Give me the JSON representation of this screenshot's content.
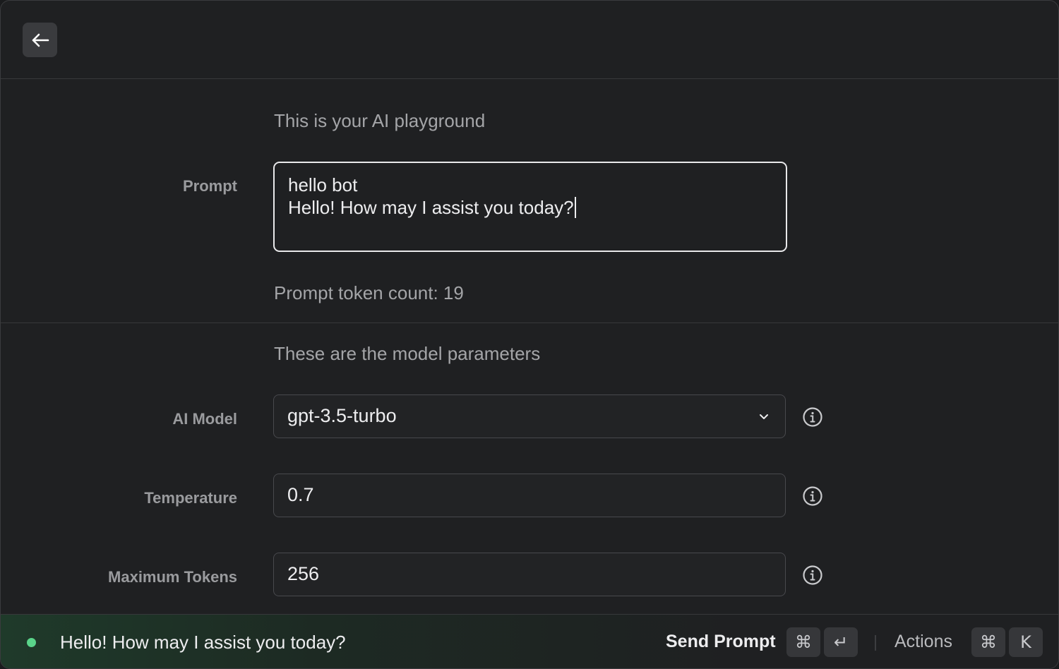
{
  "header": {
    "back_icon": "arrow-left-icon"
  },
  "prompt_section": {
    "caption": "This is your AI playground",
    "label": "Prompt",
    "lines": [
      "hello bot",
      "Hello! How may I assist you today?"
    ],
    "token_count_text": "Prompt token count: 19"
  },
  "params_section": {
    "caption": "These are the model parameters",
    "model": {
      "label": "AI Model",
      "value": "gpt-3.5-turbo",
      "icon": "chevron-down-icon"
    },
    "temperature": {
      "label": "Temperature",
      "value": "0.7"
    },
    "max_tokens": {
      "label": "Maximum Tokens",
      "value": "256"
    },
    "info_icon": "info-icon"
  },
  "statusbar": {
    "status_text": "Hello! How may I assist you today?",
    "status_color": "#5ad48a",
    "primary_action": "Send Prompt",
    "primary_keys": [
      "⌘",
      "↵"
    ],
    "secondary_action": "Actions",
    "secondary_keys": [
      "⌘",
      "K"
    ]
  }
}
